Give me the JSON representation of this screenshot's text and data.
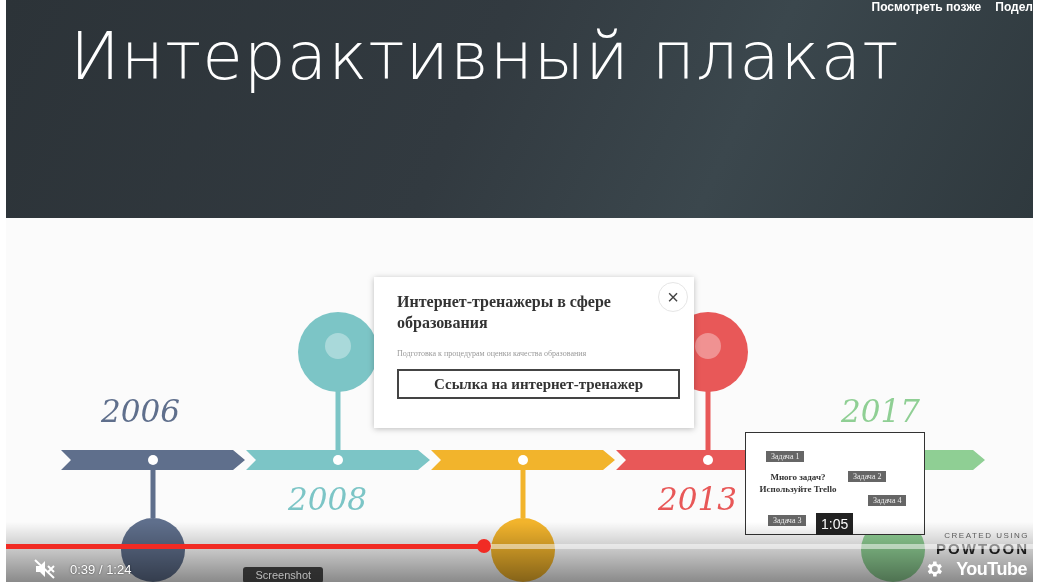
{
  "top_actions": [
    {
      "label": "Посмотреть позже"
    },
    {
      "label": "Подел"
    }
  ],
  "slide": {
    "title": "Интерактивный плакат",
    "timeline": [
      {
        "year": "2006",
        "color": "#5f6f8c",
        "kind": "below"
      },
      {
        "year": "2008",
        "color": "#7cc5c6",
        "kind": "above"
      },
      {
        "color": "#f2b42c",
        "kind": "below"
      },
      {
        "year": "2013",
        "color": "#e85858",
        "kind": "above"
      },
      {
        "year": "2017",
        "color": "#8fcf94",
        "kind": "below"
      }
    ]
  },
  "popup": {
    "title": "Интернет-тренажеры в сфере образования",
    "subtitle": "Подготовка к процедурам оценки качества образования",
    "button": "Ссылка на интернет-тренажер",
    "close": "×"
  },
  "preview": {
    "heading": "Много задач? Используйте Trello",
    "tasks": [
      "Задача 1",
      "Задача 2",
      "Задача 4",
      "Задача 3"
    ],
    "time": "1:05"
  },
  "branding": {
    "line1": "CREATED USING",
    "line2": "POWTOON"
  },
  "player": {
    "progress": {
      "level": 0.465
    },
    "muted": true,
    "time": "0:39 / 1:24",
    "tooltip": "Screenshot",
    "logo": "YouTube"
  }
}
